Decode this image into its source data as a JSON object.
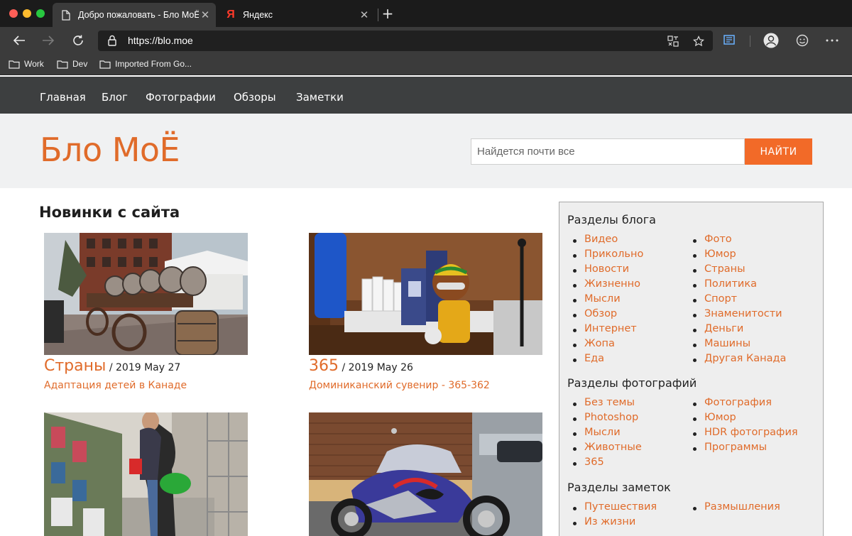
{
  "browser": {
    "tabs": [
      {
        "title": "Добро пожаловать - Бло МоЁ",
        "active": true
      },
      {
        "title": "Яндекс",
        "active": false,
        "logo": "Я"
      }
    ],
    "url": "https://blo.moe",
    "bookmarks": [
      "Work",
      "Dev",
      "Imported From Go..."
    ]
  },
  "site": {
    "nav": [
      "Главная",
      "Блог",
      "Фотографии",
      "Обзоры",
      "Заметки"
    ],
    "logo": "Бло МоЁ",
    "search": {
      "placeholder": "Найдется почти все",
      "button": "НАЙТИ"
    },
    "news_title": "Новинки с сайта",
    "cards": [
      {
        "category": "Страны",
        "date": " / 2019 May 27",
        "title": "Адаптация детей в Канаде"
      },
      {
        "category": "365",
        "date": " / 2019 May 26",
        "title": "Доминиканский сувенир - 365-362"
      }
    ]
  },
  "sidebar": {
    "blog": {
      "heading": "Разделы блога",
      "left": [
        "Видео",
        "Прикольно",
        "Новости",
        "Жизненно",
        "Мысли",
        "Обзор",
        "Интернет",
        "Жопа",
        "Еда"
      ],
      "right": [
        "Фото",
        "Юмор",
        "Страны",
        "Политика",
        "Спорт",
        "Знаменитости",
        "Деньги",
        "Машины",
        "Другая Канада"
      ]
    },
    "photos": {
      "heading": "Разделы фотографий",
      "left": [
        "Без темы",
        "Photoshop",
        "Мысли",
        "Животные",
        "365"
      ],
      "right": [
        "Фотография",
        "Юмор",
        "HDR фотография",
        "Программы"
      ]
    },
    "notes": {
      "heading": "Разделы заметок",
      "left": [
        "Путешествия",
        "Из жизни"
      ],
      "right": [
        "Размышления"
      ]
    }
  },
  "colors": {
    "accent": "#e06b2a",
    "button": "#f26a28",
    "nav_bg": "#3d3f40"
  }
}
